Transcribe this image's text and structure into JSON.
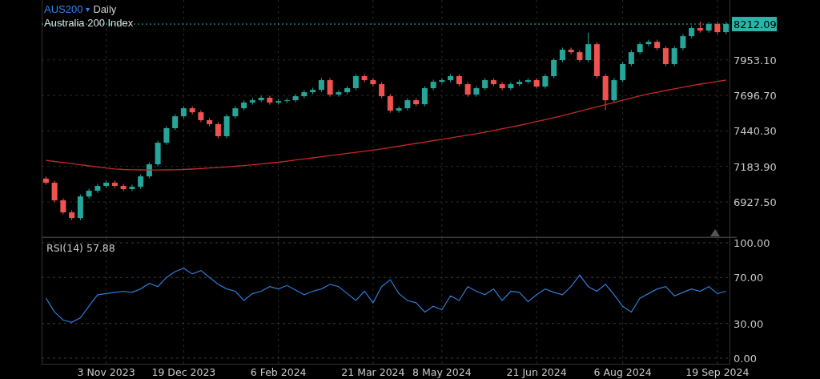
{
  "header": {
    "symbol": "AUS200",
    "dropdown_glyph": "▾",
    "interval": "Daily",
    "instrument_name": "Australia 200 Index"
  },
  "price_panel": {
    "chart_data": {
      "type": "candlestick",
      "grid": true,
      "ref_lines": [
        {
          "axis": "y",
          "value": 8212.09,
          "color": "#2bb5a8",
          "label": "8212.09"
        }
      ],
      "categories": [
        null,
        null,
        null,
        null,
        null,
        null,
        null,
        null,
        null,
        null,
        null,
        null,
        null,
        null,
        null,
        null,
        null,
        null,
        null,
        null,
        null,
        null,
        null,
        null,
        null,
        null,
        null,
        null,
        null,
        null,
        null,
        null,
        null,
        null,
        null,
        null,
        null,
        null,
        null,
        null,
        null,
        null,
        null,
        null,
        null,
        null,
        null,
        null,
        null,
        null,
        null,
        null,
        null,
        null,
        null,
        null,
        null,
        null,
        null,
        null,
        null,
        null,
        null,
        null,
        null,
        null,
        null,
        null,
        null,
        null,
        null,
        null,
        null,
        null,
        null,
        null,
        null,
        null,
        null,
        null
      ],
      "ohlc": [
        [
          7096,
          7111,
          7051,
          7066
        ],
        [
          7066,
          7081,
          6924,
          6939
        ],
        [
          6939,
          6954,
          6837,
          6852
        ],
        [
          6852,
          6867,
          6796,
          6811
        ],
        [
          6811,
          6982,
          6796,
          6967
        ],
        [
          6967,
          7023,
          6952,
          7008
        ],
        [
          7008,
          7058,
          6993,
          7043
        ],
        [
          7043,
          7081,
          7028,
          7066
        ],
        [
          7066,
          7081,
          7028,
          7043
        ],
        [
          7043,
          7058,
          7005,
          7020
        ],
        [
          7020,
          7052,
          7005,
          7037
        ],
        [
          7037,
          7127,
          7022,
          7112
        ],
        [
          7112,
          7214,
          7097,
          7199
        ],
        [
          7199,
          7370,
          7184,
          7355
        ],
        [
          7355,
          7475,
          7340,
          7460
        ],
        [
          7460,
          7561,
          7445,
          7546
        ],
        [
          7546,
          7619,
          7531,
          7604
        ],
        [
          7604,
          7619,
          7560,
          7575
        ],
        [
          7575,
          7590,
          7503,
          7518
        ],
        [
          7518,
          7533,
          7474,
          7489
        ],
        [
          7489,
          7504,
          7387,
          7402
        ],
        [
          7402,
          7561,
          7387,
          7546
        ],
        [
          7546,
          7619,
          7531,
          7604
        ],
        [
          7604,
          7660,
          7589,
          7645
        ],
        [
          7645,
          7677,
          7630,
          7662
        ],
        [
          7662,
          7695,
          7647,
          7680
        ],
        [
          7680,
          7695,
          7630,
          7645
        ],
        [
          7645,
          7671,
          7630,
          7656
        ],
        [
          7656,
          7677,
          7641,
          7662
        ],
        [
          7662,
          7706,
          7647,
          7691
        ],
        [
          7691,
          7735,
          7676,
          7720
        ],
        [
          7720,
          7752,
          7705,
          7737
        ],
        [
          7737,
          7822,
          7722,
          7807
        ],
        [
          7807,
          7822,
          7688,
          7703
        ],
        [
          7703,
          7735,
          7688,
          7720
        ],
        [
          7720,
          7764,
          7705,
          7749
        ],
        [
          7749,
          7851,
          7734,
          7836
        ],
        [
          7836,
          7851,
          7792,
          7807
        ],
        [
          7807,
          7822,
          7763,
          7778
        ],
        [
          7778,
          7793,
          7676,
          7691
        ],
        [
          7691,
          7706,
          7572,
          7587
        ],
        [
          7587,
          7619,
          7572,
          7604
        ],
        [
          7604,
          7677,
          7589,
          7662
        ],
        [
          7662,
          7677,
          7618,
          7633
        ],
        [
          7633,
          7764,
          7618,
          7749
        ],
        [
          7749,
          7810,
          7734,
          7795
        ],
        [
          7795,
          7822,
          7780,
          7807
        ],
        [
          7807,
          7851,
          7792,
          7836
        ],
        [
          7836,
          7851,
          7763,
          7778
        ],
        [
          7778,
          7793,
          7688,
          7703
        ],
        [
          7703,
          7764,
          7688,
          7749
        ],
        [
          7749,
          7822,
          7734,
          7807
        ],
        [
          7807,
          7822,
          7763,
          7778
        ],
        [
          7778,
          7793,
          7734,
          7749
        ],
        [
          7749,
          7793,
          7734,
          7778
        ],
        [
          7778,
          7810,
          7763,
          7795
        ],
        [
          7795,
          7822,
          7780,
          7807
        ],
        [
          7807,
          7822,
          7746,
          7761
        ],
        [
          7761,
          7851,
          7746,
          7836
        ],
        [
          7836,
          7967,
          7821,
          7952
        ],
        [
          7952,
          8042,
          7937,
          8027
        ],
        [
          8027,
          8042,
          7994,
          8009
        ],
        [
          8009,
          8024,
          7937,
          7952
        ],
        [
          7952,
          8150,
          7937,
          8067
        ],
        [
          8067,
          8082,
          7821,
          7836
        ],
        [
          7836,
          7851,
          7590,
          7662
        ],
        [
          7662,
          7822,
          7647,
          7807
        ],
        [
          7807,
          7938,
          7792,
          7923
        ],
        [
          7923,
          8024,
          7908,
          8009
        ],
        [
          8009,
          8082,
          7994,
          8067
        ],
        [
          8067,
          8099,
          8052,
          8084
        ],
        [
          8084,
          8099,
          8023,
          8038
        ],
        [
          8038,
          8053,
          7908,
          7923
        ],
        [
          7923,
          8053,
          7908,
          8038
        ],
        [
          8038,
          8140,
          8023,
          8125
        ],
        [
          8125,
          8198,
          8110,
          8183
        ],
        [
          8183,
          8230,
          8150,
          8165
        ],
        [
          8165,
          8227,
          8150,
          8212
        ],
        [
          8212,
          8227,
          8139,
          8154
        ],
        [
          8154,
          8227,
          8139,
          8212
        ]
      ],
      "series": [
        {
          "type": "line",
          "color": "#c62828",
          "values": [
            7228,
            7220,
            7212,
            7204,
            7196,
            7188,
            7180,
            7172,
            7166,
            7162,
            7160,
            7159,
            7158,
            7158,
            7159,
            7160,
            7162,
            7165,
            7168,
            7172,
            7176,
            7180,
            7185,
            7190,
            7196,
            7202,
            7208,
            7214,
            7222,
            7230,
            7238,
            7246,
            7254,
            7262,
            7270,
            7278,
            7286,
            7294,
            7302,
            7310,
            7320,
            7330,
            7340,
            7350,
            7360,
            7370,
            7380,
            7390,
            7400,
            7410,
            7420,
            7432,
            7444,
            7456,
            7468,
            7480,
            7494,
            7508,
            7522,
            7536,
            7550,
            7566,
            7582,
            7598,
            7614,
            7630,
            7646,
            7662,
            7678,
            7694,
            7708,
            7720,
            7732,
            7744,
            7756,
            7768,
            7778,
            7788,
            7798,
            7807
          ]
        }
      ],
      "ylim": [
        6667,
        8386
      ],
      "yticks": [
        {
          "value": 7953.1,
          "label": "7953.10"
        },
        {
          "value": 7696.7,
          "label": "7696.70"
        },
        {
          "value": 7440.3,
          "label": "7440.30"
        },
        {
          "value": 7183.9,
          "label": "7183.90"
        },
        {
          "value": 6927.5,
          "label": "6927.50"
        }
      ]
    }
  },
  "rsi_panel": {
    "label": "RSI(14) 57.88",
    "chart_data": {
      "type": "line",
      "grid": true,
      "categories": [
        null,
        null,
        null,
        null,
        null,
        null,
        null,
        "3 Nov 2023",
        null,
        null,
        null,
        null,
        null,
        null,
        null,
        null,
        "19 Dec 2023",
        null,
        null,
        null,
        null,
        null,
        null,
        null,
        null,
        null,
        null,
        "6 Feb 2024",
        null,
        null,
        null,
        null,
        null,
        null,
        null,
        null,
        null,
        null,
        "21 Mar 2024",
        null,
        null,
        null,
        null,
        null,
        null,
        null,
        "8 May 2024",
        null,
        null,
        null,
        null,
        null,
        null,
        null,
        null,
        null,
        null,
        "21 Jun 2024",
        null,
        null,
        null,
        null,
        null,
        null,
        null,
        null,
        null,
        "6 Aug 2024",
        null,
        null,
        null,
        null,
        null,
        null,
        null,
        null,
        null,
        null,
        "19 Sep 2024",
        null
      ],
      "series": [
        {
          "color": "#2f7bd6",
          "values": [
            52,
            40,
            33,
            31,
            35,
            45,
            55,
            56,
            57,
            58,
            57,
            60,
            65,
            62,
            70,
            75,
            78,
            73,
            76,
            70,
            64,
            60,
            58,
            50,
            56,
            58,
            62,
            60,
            63,
            59,
            55,
            58,
            60,
            64,
            62,
            56,
            50,
            58,
            48,
            62,
            68,
            56,
            50,
            48,
            40,
            45,
            42,
            54,
            50,
            62,
            58,
            55,
            60,
            50,
            58,
            57,
            49,
            55,
            60,
            57,
            55,
            62,
            72,
            62,
            58,
            64,
            55,
            45,
            40,
            52,
            56,
            60,
            62,
            54,
            57,
            60,
            58,
            62,
            56,
            58
          ]
        }
      ],
      "ylim": [
        -5.6,
        104.2
      ],
      "yticks": [
        {
          "value": 100,
          "label": "100.00"
        },
        {
          "value": 70,
          "label": "70.00"
        },
        {
          "value": 30,
          "label": "30.00"
        },
        {
          "value": 0,
          "label": "0.00"
        }
      ]
    }
  }
}
